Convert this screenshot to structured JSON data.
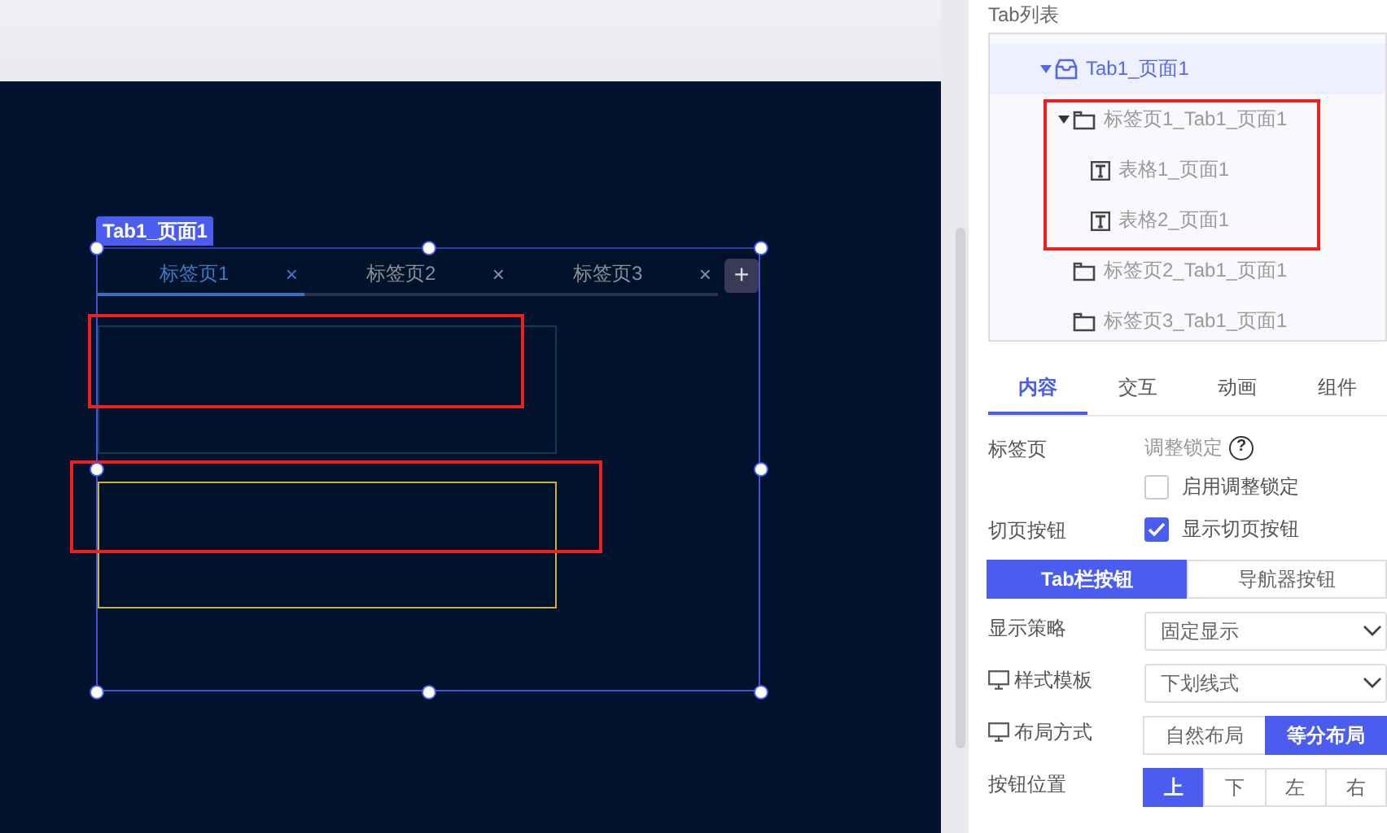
{
  "canvas": {
    "component_label": "Tab1_页面1",
    "tabs": [
      {
        "label": "标签页1",
        "close": "×",
        "selected": true
      },
      {
        "label": "标签页2",
        "close": "×",
        "selected": false
      },
      {
        "label": "标签页3",
        "close": "×",
        "selected": false
      }
    ],
    "add_button": "+"
  },
  "panel": {
    "title": "Tab列表"
  },
  "tree": [
    {
      "label": "Tab1_页面1",
      "kind": "tab",
      "selected": true,
      "expanded": true,
      "children": [
        {
          "label": "标签页1_Tab1_页面1",
          "kind": "page",
          "selected": false,
          "expanded": true,
          "children": [
            {
              "label": "表格1_页面1",
              "kind": "table",
              "selected": false
            },
            {
              "label": "表格2_页面1",
              "kind": "table",
              "selected": false
            }
          ]
        },
        {
          "label": "标签页2_Tab1_页面1",
          "kind": "page",
          "selected": false
        },
        {
          "label": "标签页3_Tab1_页面1",
          "kind": "page",
          "selected": false
        }
      ]
    }
  ],
  "property_tabs": [
    {
      "label": "内容",
      "selected": true
    },
    {
      "label": "交互",
      "selected": false
    },
    {
      "label": "动画",
      "selected": false
    },
    {
      "label": "组件",
      "selected": false
    }
  ],
  "form": [
    {
      "kind": "lock",
      "label": "标签页",
      "hint": "调整锁定",
      "help": "?",
      "checkbox": {
        "label": "启用调整锁定",
        "checked": false
      }
    },
    {
      "kind": "check",
      "label": "切页按钮",
      "checkbox": {
        "label": "显示切页按钮",
        "checked": true
      }
    },
    {
      "kind": "segmented",
      "options": [
        {
          "label": "Tab栏按钮",
          "selected": true
        },
        {
          "label": "导航器按钮",
          "selected": false
        }
      ]
    },
    {
      "kind": "select",
      "label": "显示策略",
      "has_icon": false,
      "value": "固定显示"
    },
    {
      "kind": "select",
      "label": "样式模板",
      "has_icon": true,
      "value": "下划线式"
    },
    {
      "kind": "segmented",
      "label": "布局方式",
      "has_icon": true,
      "options": [
        {
          "label": "自然布局",
          "selected": false
        },
        {
          "label": "等分布局",
          "selected": true
        }
      ]
    },
    {
      "kind": "segmented",
      "label": "按钮位置",
      "has_icon": false,
      "options": [
        {
          "label": "上",
          "selected": true
        },
        {
          "label": "下",
          "selected": false
        },
        {
          "label": "左",
          "selected": false
        },
        {
          "label": "右",
          "selected": false
        }
      ]
    }
  ]
}
